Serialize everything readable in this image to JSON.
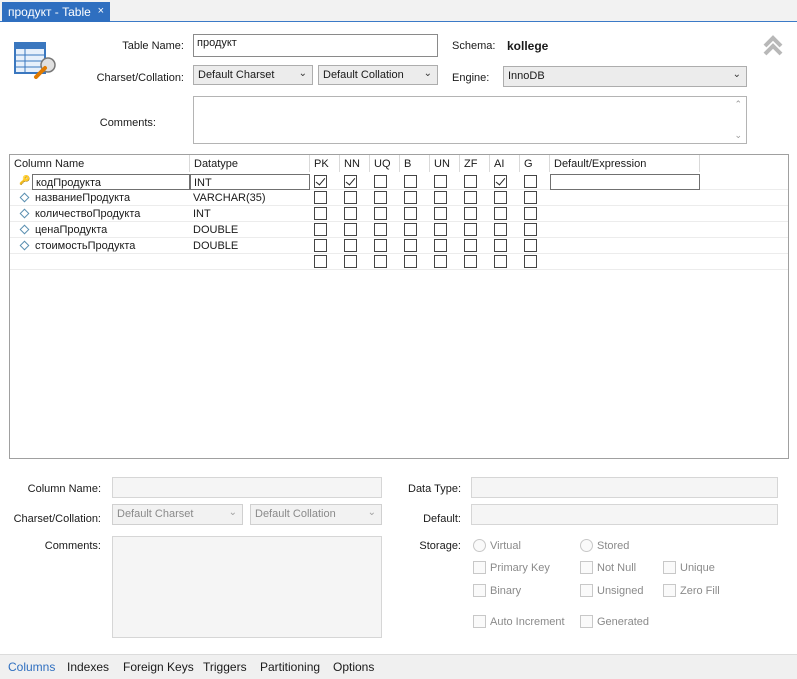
{
  "tab": {
    "title": "продукт - Table",
    "close": "×"
  },
  "form": {
    "table_name_label": "Table Name:",
    "table_name_value": "продукт",
    "schema_label": "Schema:",
    "schema_value": "kollege",
    "charset_label": "Charset/Collation:",
    "charset_value": "Default Charset",
    "collation_value": "Default Collation",
    "engine_label": "Engine:",
    "engine_value": "InnoDB",
    "comments_label": "Comments:",
    "comments_value": ""
  },
  "grid": {
    "headers": [
      "Column Name",
      "Datatype",
      "PK",
      "NN",
      "UQ",
      "B",
      "UN",
      "ZF",
      "AI",
      "G",
      "Default/Expression"
    ],
    "rows": [
      {
        "name": "кодПродукта",
        "type": "INT",
        "key": true,
        "flags": [
          true,
          true,
          false,
          false,
          false,
          false,
          true,
          false
        ]
      },
      {
        "name": "названиеПродукта",
        "type": "VARCHAR(35)",
        "key": false,
        "flags": [
          false,
          false,
          false,
          false,
          false,
          false,
          false,
          false
        ]
      },
      {
        "name": "количествоПродукта",
        "type": "INT",
        "key": false,
        "flags": [
          false,
          false,
          false,
          false,
          false,
          false,
          false,
          false
        ]
      },
      {
        "name": "ценаПродукта",
        "type": "DOUBLE",
        "key": false,
        "flags": [
          false,
          false,
          false,
          false,
          false,
          false,
          false,
          false
        ]
      },
      {
        "name": "стоимостьПродукта",
        "type": "DOUBLE",
        "key": false,
        "flags": [
          false,
          false,
          false,
          false,
          false,
          false,
          false,
          false
        ]
      },
      {
        "name": "",
        "type": "",
        "key": false,
        "flags": [
          false,
          false,
          false,
          false,
          false,
          false,
          false,
          false
        ]
      }
    ]
  },
  "details": {
    "column_name_label": "Column Name:",
    "charset_label": "Charset/Collation:",
    "charset_value": "Default Charset",
    "collation_value": "Default Collation",
    "comments_label": "Comments:",
    "data_type_label": "Data Type:",
    "default_label": "Default:",
    "storage_label": "Storage:",
    "virtual": "Virtual",
    "stored": "Stored",
    "primary_key": "Primary Key",
    "not_null": "Not Null",
    "unique": "Unique",
    "binary": "Binary",
    "unsigned": "Unsigned",
    "zero_fill": "Zero Fill",
    "auto_increment": "Auto Increment",
    "generated": "Generated"
  },
  "bottom_tabs": [
    "Columns",
    "Indexes",
    "Foreign Keys",
    "Triggers",
    "Partitioning",
    "Options"
  ],
  "colors": {
    "accent": "#2f6fc0",
    "key": "#d4a800"
  },
  "icons": {
    "table": "table-editor-icon",
    "collapse": "double-chevron-up-icon"
  }
}
